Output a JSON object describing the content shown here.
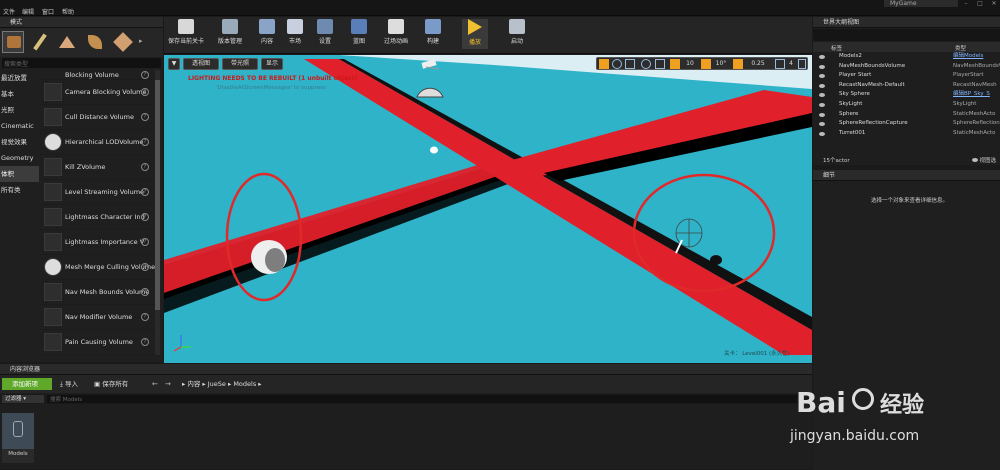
{
  "menu": [
    "文件",
    "编辑",
    "窗口",
    "帮助"
  ],
  "window_title": "MyGame",
  "modes_panel": {
    "title": "模式",
    "search_placeholder": "搜索类型",
    "categories": [
      "最近放置",
      "基本",
      "光照",
      "Cinematic",
      "视觉效果",
      "Geometry",
      "体积",
      "所有类"
    ],
    "selected_category": "体积",
    "items": [
      "Blocking Volume",
      "Camera Blocking Volume",
      "Cull Distance Volume",
      "Hierarchical LODVolume",
      "Kill ZVolume",
      "Level Streaming Volume",
      "Lightmass Character Ind",
      "Lightmass Importance V",
      "Mesh Merge Culling Volume",
      "Nav Mesh Bounds Volume",
      "Nav Modifier Volume",
      "Pain Causing Volume"
    ]
  },
  "toolbar": {
    "buttons": [
      "保存当前关卡",
      "版本管理",
      "内容",
      "市场",
      "设置",
      "蓝图",
      "过场动画",
      "构建",
      "播放",
      "启动"
    ]
  },
  "viewport": {
    "menu_label": "▼",
    "perspective": "透视图",
    "lit": "带光照",
    "show": "显示",
    "warning": "LIGHTING NEEDS TO BE REBUILT (1 unbuilt object)",
    "warning_sub": "'DisableAllScreenMessages' to suppress",
    "grid_snap": "10",
    "rot_snap": "10°",
    "scale_snap": "0.25",
    "cam_speed": "4",
    "level_label": "关卡：",
    "level_name": "Level001 (永久性)"
  },
  "outliner": {
    "title": "世界大纲视图",
    "col_label": "标签",
    "col_type": "类型",
    "rows": [
      {
        "label": "Models2",
        "type": "编辑Models",
        "link": true
      },
      {
        "label": "NavMeshBoundsVolume",
        "type": "NavMeshBoundsVo",
        "link": false
      },
      {
        "label": "Player Start",
        "type": "PlayerStart",
        "link": false
      },
      {
        "label": "RecastNavMesh-Default",
        "type": "RecastNavMesh",
        "link": false
      },
      {
        "label": "Sky Sphere",
        "type": "编辑BP_Sky_S",
        "link": true
      },
      {
        "label": "SkyLight",
        "type": "SkyLight",
        "link": false
      },
      {
        "label": "Sphere",
        "type": "StaticMeshActo",
        "link": false
      },
      {
        "label": "SphereReflectionCapture",
        "type": "SphereReflection",
        "link": false
      },
      {
        "label": "Turret001",
        "type": "StaticMeshActo",
        "link": false
      }
    ],
    "count": "15个actor",
    "view_options": "视图选"
  },
  "details": {
    "title": "细节",
    "message": "选择一个对象来查看详细信息。"
  },
  "content_browser": {
    "title": "内容浏览器",
    "add_new": "添加新项",
    "import": "导入",
    "save_all": "保存所有",
    "path": [
      "内容",
      "JueSe",
      "Models"
    ],
    "filters": "过滤器",
    "search_placeholder": "搜索 Models",
    "asset_name": "Models"
  },
  "watermark": {
    "brand": "Bai",
    "brand2": "经验",
    "url": "jingyan.baidu.com"
  },
  "colors": {
    "floor": "#2eb3c9",
    "road_red": "#e0202a",
    "road_black": "#000000",
    "circle": "#e02a2a",
    "add_new_green": "#5fa82a"
  }
}
